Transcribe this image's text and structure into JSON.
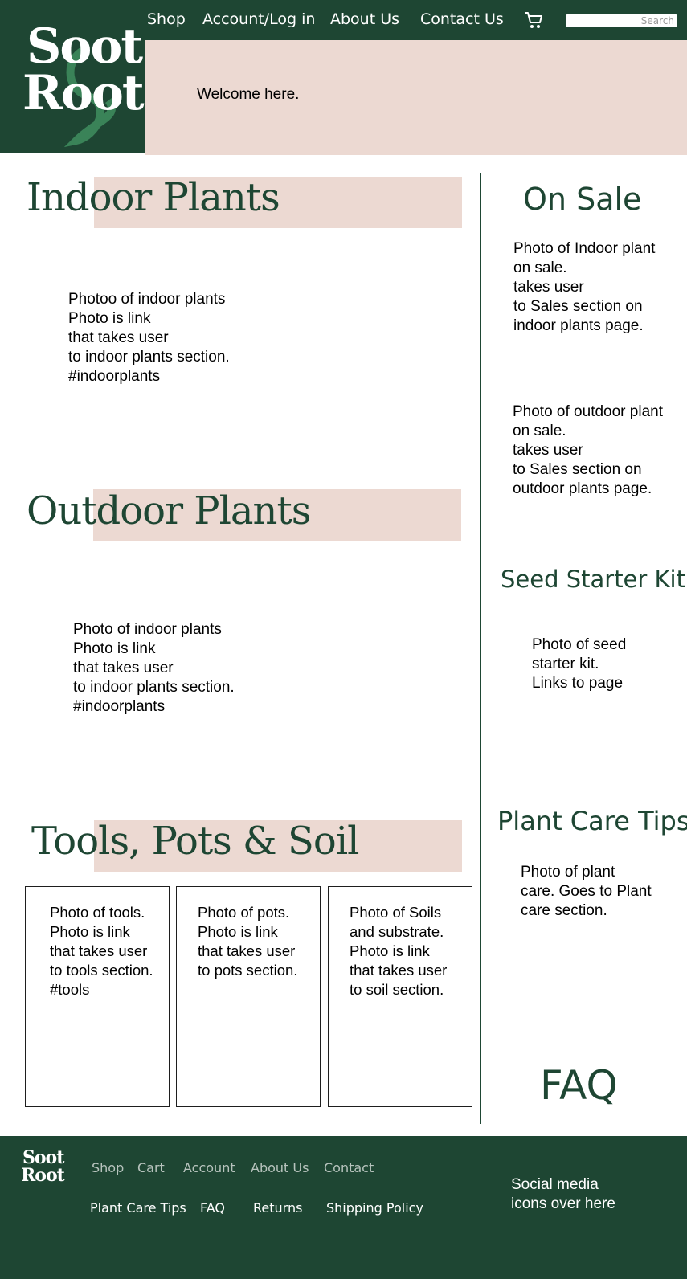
{
  "header": {
    "logo_text": [
      "Soot",
      "Root"
    ],
    "nav": [
      "Shop",
      "Account/Log in",
      "About Us",
      "Contact Us"
    ],
    "cart_icon": "shopping-cart-icon",
    "search_placeholder": "Search",
    "welcome": "Welcome here."
  },
  "main": {
    "indoor": {
      "title": "Indoor Plants",
      "text": "Photoo of indoor plants\nPhoto is link\nthat takes user\nto indoor plants section.\n#indoorplants"
    },
    "outdoor": {
      "title": "Outdoor Plants",
      "text": "Photo of indoor plants\nPhoto is link\nthat takes user\nto indoor plants section.\n#indoorplants"
    },
    "tools": {
      "title": "Tools, Pots & Soil",
      "cards": [
        "Photo of tools.\nPhoto is link\nthat takes user\nto tools section.\n#tools",
        "Photo of pots.\nPhoto is link\nthat takes user\nto pots section.",
        "Photo of Soils\nand substrate.\nPhoto is link\nthat takes user\nto soil section."
      ]
    }
  },
  "sidebar": {
    "on_sale_title": "On Sale",
    "on_sale_indoor": "Photo of Indoor plant\non sale.\ntakes user\nto Sales section on\nindoor plants page.",
    "on_sale_outdoor": "Photo of outdoor plant\non sale.\ntakes user\nto Sales section on\noutdoor plants page.",
    "seed_title": "Seed Starter Kit",
    "seed_text": "Photo of seed\nstarter kit.\nLinks to page",
    "care_title": "Plant Care Tips",
    "care_text": "Photo of plant\ncare. Goes to Plant\ncare section.",
    "faq": "FAQ"
  },
  "footer": {
    "logo_text": [
      "Soot",
      "Root"
    ],
    "row1": [
      "Shop",
      "Cart",
      "Account",
      "About Us",
      "Contact"
    ],
    "row2": [
      "Plant Care Tips",
      "FAQ",
      "Returns",
      "Shipping Policy"
    ],
    "social": "Social media\nicons over here"
  },
  "colors": {
    "brand_green": "#1e4633",
    "blush": "#ecd9d2",
    "white": "#ffffff"
  }
}
